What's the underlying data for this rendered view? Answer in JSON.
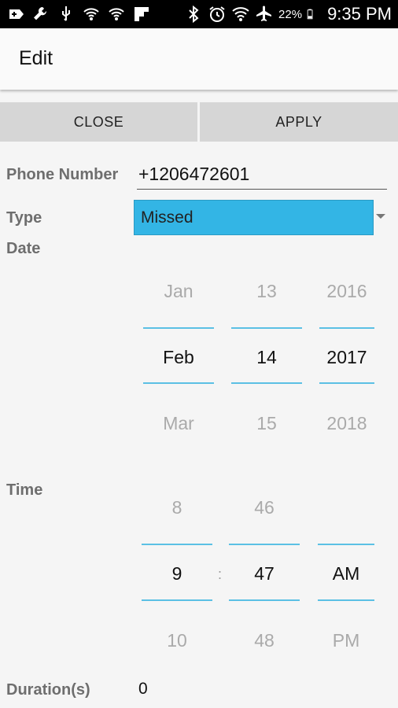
{
  "status_bar": {
    "battery": "22%",
    "time": "9:35 PM",
    "icons": [
      "add-icon",
      "wrench-icon",
      "usb-icon",
      "wifi-shield-icon",
      "wifi-shield-icon",
      "flipboard-icon",
      "bluetooth-icon",
      "alarm-icon",
      "wifi-icon",
      "airplane-icon",
      "battery-icon"
    ]
  },
  "action_bar": {
    "title": "Edit"
  },
  "buttons": {
    "close": "CLOSE",
    "apply": "APPLY"
  },
  "labels": {
    "phone": "Phone Number",
    "type": "Type",
    "date": "Date",
    "time": "Time",
    "duration": "Duration(s)"
  },
  "fields": {
    "phone": "+1206472601",
    "type": "Missed",
    "duration": "0"
  },
  "date_picker": {
    "month": {
      "prev": "Jan",
      "selected": "Feb",
      "next": "Mar"
    },
    "day": {
      "prev": "13",
      "selected": "14",
      "next": "15"
    },
    "year": {
      "prev": "2016",
      "selected": "2017",
      "next": "2018"
    }
  },
  "time_picker": {
    "hour": {
      "prev": "8",
      "selected": "9",
      "next": "10"
    },
    "minute": {
      "prev": "46",
      "selected": "47",
      "next": "48"
    },
    "ampm": {
      "selected": "AM",
      "next": "PM"
    },
    "separator": ":"
  },
  "colors": {
    "accent": "#33b5e5",
    "picker_line": "#5bc0e4",
    "button_bg": "#d6d6d6",
    "background": "#f5f5f5"
  }
}
